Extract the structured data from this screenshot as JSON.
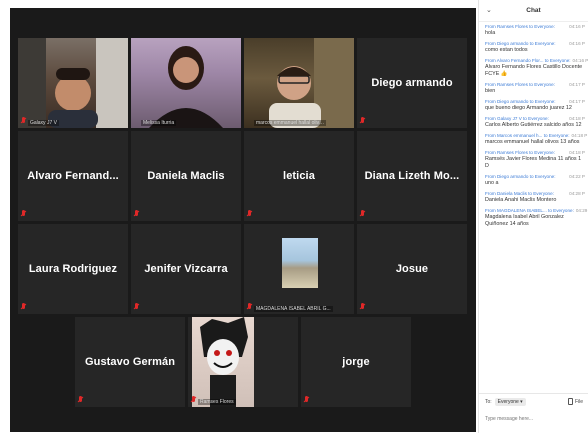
{
  "participants": [
    {
      "name": "Galaxy J7 V",
      "show_label": true
    },
    {
      "name": "Melissa Iturria",
      "show_label": true
    },
    {
      "name": "marcos emmanuel hallal oliv…",
      "show_label": true
    },
    {
      "name": "Diego armando"
    },
    {
      "name": "Alvaro Fernand..."
    },
    {
      "name": "Daniela Maclis"
    },
    {
      "name": "leticia"
    },
    {
      "name": "Diana Lizeth Mo..."
    },
    {
      "name": "Laura Rodriguez"
    },
    {
      "name": "Jenifer Vizcarra"
    },
    {
      "name": "MAGDALENA ISABEL ABRIL G...",
      "show_label": true
    },
    {
      "name": "Josue"
    },
    {
      "name": "Gustavo Germán"
    },
    {
      "name": "Ramses Flores",
      "show_label": true
    },
    {
      "name": "jorge"
    }
  ],
  "chat": {
    "title": "Chat",
    "collapse_icon": "chevron-down-icon",
    "messages": [
      {
        "meta": "From Ramses Flores to Everyone:",
        "time": "04:16 P",
        "text": "hola"
      },
      {
        "meta": "From Diego armando to Everyone:",
        "time": "04:16 P",
        "text": "como estan todos"
      },
      {
        "meta": "From Alvaro Fernando Flor... to Everyone:",
        "time": "04:16 P",
        "text": "Alvaro Fernando Flores Castillo Docente FCYE 👍"
      },
      {
        "meta": "From Ramses Flores to Everyone:",
        "time": "04:17 P",
        "text": "bien"
      },
      {
        "meta": "From Diego armando to Everyone:",
        "time": "04:17 P",
        "text": "que bueno diego Armando juarez 12"
      },
      {
        "meta": "From Galaxy J7 V to Everyone:",
        "time": "04:18 P",
        "text": "Carlos Alberto Gutiérrez salcido años 12"
      },
      {
        "meta": "From Marcos emmanuel h... to Everyone:",
        "time": "04:18 P",
        "text": "marcos emmanuel hallal olivos 13 años"
      },
      {
        "meta": "From Ramses Flores to Everyone:",
        "time": "04:18 P",
        "text": "Ramsés Javier Flores Medina 11 años 1 D"
      },
      {
        "meta": "From Diego armando to Everyone:",
        "time": "04:22 P",
        "text": "uno a"
      },
      {
        "meta": "From Daniela Maclis to Everyone:",
        "time": "04:28 P",
        "text": "Daniela Anahi Maclis Montero"
      },
      {
        "meta": "From MAGDALENA ISABEL... to Everyone:",
        "time": "04:29 P",
        "text": "Magdalena Isabel Abril Gonzalez Quiñonez 14 años"
      }
    ],
    "to_label": "To:",
    "to_value": "Everyone ▾",
    "file_label": "File",
    "input_placeholder": "Type message here..."
  }
}
